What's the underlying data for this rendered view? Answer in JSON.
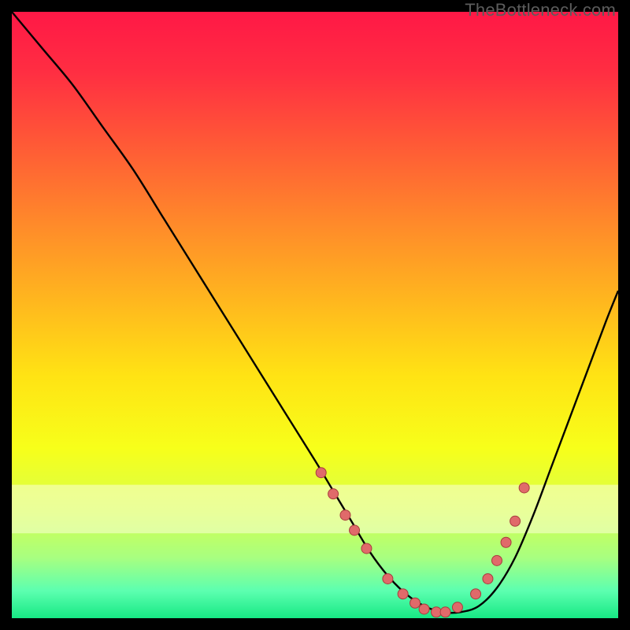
{
  "watermark": "TheBottleneck.com",
  "colors": {
    "gradient_stops": [
      {
        "offset": 0.0,
        "color": "#ff1846"
      },
      {
        "offset": 0.1,
        "color": "#ff2e42"
      },
      {
        "offset": 0.22,
        "color": "#ff5a36"
      },
      {
        "offset": 0.35,
        "color": "#ff8a2a"
      },
      {
        "offset": 0.48,
        "color": "#ffb81e"
      },
      {
        "offset": 0.6,
        "color": "#ffe314"
      },
      {
        "offset": 0.72,
        "color": "#f7ff1a"
      },
      {
        "offset": 0.82,
        "color": "#d8ff4a"
      },
      {
        "offset": 0.9,
        "color": "#a8ff80"
      },
      {
        "offset": 0.955,
        "color": "#5cffb0"
      },
      {
        "offset": 1.0,
        "color": "#17e884"
      }
    ],
    "pale_band": "#faffd8",
    "curve": "#000000",
    "dot_fill": "#e06a6a",
    "dot_stroke": "#a83d3d"
  },
  "chart_data": {
    "type": "line",
    "title": "",
    "xlabel": "",
    "ylabel": "",
    "xlim": [
      0,
      100
    ],
    "ylim": [
      0,
      100
    ],
    "series": [
      {
        "name": "bottleneck-curve",
        "x": [
          0,
          5,
          10,
          15,
          20,
          25,
          30,
          35,
          40,
          45,
          50,
          53,
          56,
          59,
          62,
          65,
          68,
          71,
          74,
          77,
          80,
          83,
          86,
          89,
          92,
          95,
          98,
          100
        ],
        "y": [
          100,
          94,
          88,
          81,
          74,
          66,
          58,
          50,
          42,
          34,
          26,
          21,
          16,
          11,
          7,
          4,
          2,
          1,
          1,
          2,
          5,
          10,
          17,
          25,
          33,
          41,
          49,
          54
        ]
      }
    ],
    "markers": {
      "name": "sample-points",
      "x": [
        51,
        53,
        55,
        56.5,
        58.5,
        62,
        64.5,
        66.5,
        68,
        70,
        71.5,
        73.5,
        76.5,
        78.5,
        80,
        81.5,
        83,
        84.5
      ],
      "y": [
        24,
        20.5,
        17,
        14.5,
        11.5,
        6.5,
        4,
        2.5,
        1.5,
        1,
        1,
        1.8,
        4,
        6.5,
        9.5,
        12.5,
        16,
        21.5
      ]
    }
  }
}
